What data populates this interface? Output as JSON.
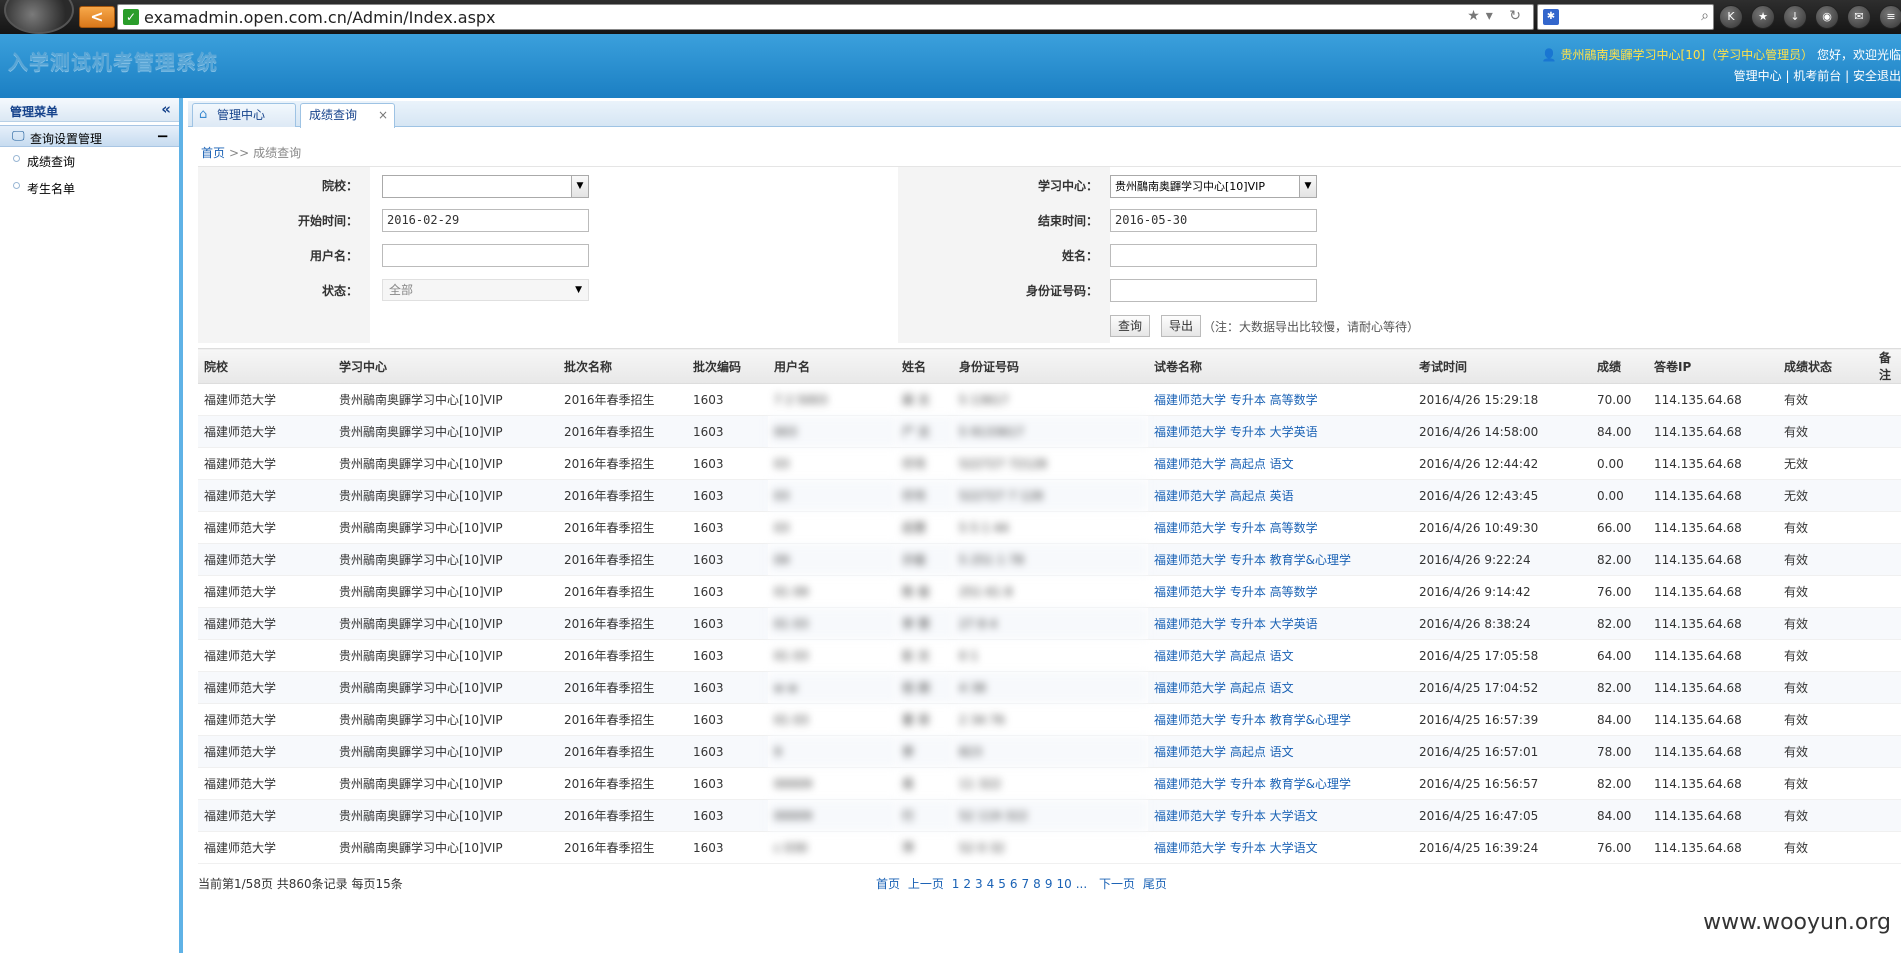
{
  "browser": {
    "url": "examadmin.open.com.cn/Admin/Index.aspx",
    "back_glyph": "<"
  },
  "header": {
    "system_title": "入学测试机考管理系统",
    "user_name": "贵州鷊南奥鼲学习中心[10]（学习中心管理员）",
    "greeting": "您好，欢迎光临",
    "links": [
      "管理中心",
      "机考前台",
      "安全退出"
    ]
  },
  "sidebar": {
    "title": "管理菜单",
    "group_label": "查询设置管理",
    "items": [
      "成绩查询",
      "考生名单"
    ]
  },
  "tabs": [
    {
      "label": "管理中心"
    },
    {
      "label": "成绩查询",
      "close": "×"
    }
  ],
  "breadcrumb": {
    "home": "首页",
    "sep": ">>",
    "current": "成绩查询"
  },
  "filters": {
    "school_label": "院校：",
    "school_value": "",
    "start_label": "开始时间：",
    "start_value": "2016-02-29",
    "username_label": "用户名：",
    "username_value": "",
    "status_label": "状态：",
    "status_value": "全部",
    "center_label": "学习中心：",
    "center_value": "贵州鷊南奥鼲学习中心[10]VIP",
    "end_label": "结束时间：",
    "end_value": "2016-05-30",
    "name_label": "姓名：",
    "name_value": "",
    "idcard_label": "身份证号码：",
    "idcard_value": "",
    "query_button": "查询",
    "export_button": "导出",
    "export_note": "（注：大数据导出比较慢，请耐心等待）"
  },
  "table": {
    "columns": [
      "院校",
      "学习中心",
      "批次名称",
      "批次编码",
      "用户名",
      "姓名",
      "身份证号码",
      "试卷名称",
      "考试时间",
      "成绩",
      "答卷IP",
      "成绩状态",
      "备注"
    ],
    "rows": [
      [
        "福建师范大学",
        "贵州鷊南奥鼲学习中心[10]VIP",
        "2016年春季招生",
        "1603",
        "7    2    5003",
        "屎  文",
        "5            13617",
        "福建师范大学 专升本 高等数学",
        "2016/4/26 15:29:18",
        "70.00",
        "114.135.64.68",
        "有效",
        ""
      ],
      [
        "福建师范大学",
        "贵州鷊南奥鼲学习中心[10]VIP",
        "2016年春季招生",
        "1603",
        "          003",
        "尸  文",
        "5          9133617",
        "福建师范大学 专升本 大学英语",
        "2016/4/26 14:58:00",
        "84.00",
        "114.135.64.68",
        "有效",
        ""
      ],
      [
        "福建师范大学",
        "贵州鷊南奥鼲学习中心[10]VIP",
        "2016年春季招生",
        "1603",
        "          03",
        "  仔月",
        "522727      72128",
        "福建师范大学 高起点 语文",
        "2016/4/26 12:44:42",
        "0.00",
        "114.135.64.68",
        "无效",
        ""
      ],
      [
        "福建师范大学",
        "贵州鷊南奥鼲学习中心[10]VIP",
        "2016年春季招生",
        "1603",
        "          03",
        "  仔月",
        "522727       7 128",
        "福建师范大学 高起点 英语",
        "2016/4/26 12:43:45",
        "0.00",
        "114.135.64.68",
        "无效",
        ""
      ],
      [
        "福建师范大学",
        "贵州鷊南奥鼲学习中心[10]VIP",
        "2016年春季招生",
        "1603",
        "          03",
        "  后慧",
        "5    5  1        44",
        "福建师范大学 专升本 高等数学",
        "2016/4/26 10:49:30",
        "66.00",
        "114.135.64.68",
        "有效",
        ""
      ],
      [
        "福建师范大学",
        "贵州鷊南奥鼲学习中心[10]VIP",
        "2016年春季招生",
        "1603",
        "          09",
        "  示俊",
        "5    251   1    78",
        "福建师范大学 专升本 教育学&心理学",
        "2016/4/26 9:22:24",
        "82.00",
        "114.135.64.68",
        "有效",
        ""
      ],
      [
        "福建师范大学",
        "贵州鷊南奥鼲学习中心[10]VIP",
        "2016年春季招生",
        "1603",
        "    01    09",
        "陈  俊",
        "   251    61    8",
        "福建师范大学 专升本 高等数学",
        "2016/4/26 9:14:42",
        "76.00",
        "114.135.64.68",
        "有效",
        ""
      ],
      [
        "福建师范大学",
        "贵州鷊南奥鼲学习中心[10]VIP",
        "2016年春季招生",
        "1603",
        "    01    03",
        "李  慧",
        "    27   8       4",
        "福建师范大学 专升本 大学英语",
        "2016/4/26 8:38:24",
        "82.00",
        "114.135.64.68",
        "有效",
        ""
      ],
      [
        "福建师范大学",
        "贵州鷊南奥鼲学习中心[10]VIP",
        "2016年春季招生",
        "1603",
        "    01    03",
        "彭  文",
        "         0       1",
        "福建师范大学 高起点 语文",
        "2016/4/25 17:05:58",
        "64.00",
        "114.135.64.68",
        "有效",
        ""
      ],
      [
        "福建师范大学",
        "贵州鷊南奥鼲学习中心[10]VIP",
        "2016年春季招生",
        "1603",
        "    w    w",
        "但  朋",
        "       4        38",
        "福建师范大学 高起点 语文",
        "2016/4/25 17:04:52",
        "82.00",
        "114.135.64.68",
        "有效",
        ""
      ],
      [
        "福建师范大学",
        "贵州鷊南奥鼲学习中心[10]VIP",
        "2016年春季招生",
        "1603",
        "    01    03",
        "董  菲",
        "     2    34     76",
        "福建师范大学 专升本 教育学&心理学",
        "2016/4/25 16:57:39",
        "84.00",
        "114.135.64.68",
        "有效",
        ""
      ],
      [
        "福建师范大学",
        "贵州鷊南奥鼲学习中心[10]VIP",
        "2016年春季招生",
        "1603",
        "          9",
        "李  ",
        "              823",
        "福建师范大学 高起点 语文",
        "2016/4/25 16:57:01",
        "78.00",
        "114.135.64.68",
        "有效",
        ""
      ],
      [
        "福建师范大学",
        "贵州鷊南奥鼲学习中心[10]VIP",
        "2016年春季招生",
        "1603",
        "      00009",
        "易  ",
        "      11        322",
        "福建师范大学 专升本 教育学&心理学",
        "2016/4/25 16:56:57",
        "82.00",
        "114.135.64.68",
        "有效",
        ""
      ],
      [
        "福建师范大学",
        "贵州鷊南奥鼲学习中心[10]VIP",
        "2016年春季招生",
        "1603",
        "      00009",
        "  行",
        "52    119       322",
        "福建师范大学 专升本 大学语文",
        "2016/4/25 16:47:05",
        "84.00",
        "114.135.64.68",
        "有效",
        ""
      ],
      [
        "福建师范大学",
        "贵州鷊南奥鼲学习中心[10]VIP",
        "2016年春季招生",
        "1603",
        "c        030",
        "  萍",
        "52          0    32",
        "福建师范大学 专升本 大学语文",
        "2016/4/25 16:39:24",
        "76.00",
        "114.135.64.68",
        "有效",
        ""
      ]
    ]
  },
  "pagination": {
    "info": "当前第1/58页 共860条记录 每页15条",
    "first": "首页",
    "prev": "上一页",
    "pages": [
      "1",
      "2",
      "3",
      "4",
      "5",
      "6",
      "7",
      "8",
      "9",
      "10",
      "..."
    ],
    "next": "下一页",
    "last": "尾页"
  },
  "watermark": "www.wooyun.org"
}
